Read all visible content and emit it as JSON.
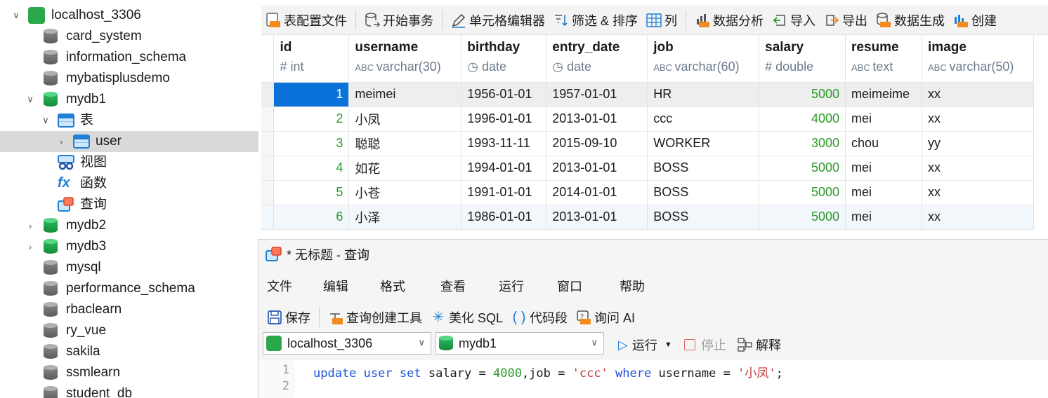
{
  "sidebar": {
    "connection": "localhost_3306",
    "databases": [
      "card_system",
      "information_schema",
      "mybatisplusdemo",
      "mydb1"
    ],
    "mydb1_children": {
      "tables_label": "表",
      "table_user": "user",
      "views_label": "视图",
      "functions_label": "函数",
      "queries_label": "查询"
    },
    "more_databases": [
      "mydb2",
      "mydb3",
      "mysql",
      "performance_schema",
      "rbaclearn",
      "ry_vue",
      "sakila",
      "ssmlearn",
      "student_db"
    ]
  },
  "toolbar": {
    "table_config": "表配置文件",
    "begin_tx": "开始事务",
    "cell_editor": "单元格编辑器",
    "filter_sort": "筛选 & 排序",
    "columns": "列",
    "data_analysis": "数据分析",
    "import": "导入",
    "export": "导出",
    "data_gen": "数据生成",
    "create": "创建"
  },
  "grid": {
    "columns": [
      {
        "name": "id",
        "type": "int"
      },
      {
        "name": "username",
        "type": "varchar(30)"
      },
      {
        "name": "birthday",
        "type": "date"
      },
      {
        "name": "entry_date",
        "type": "date"
      },
      {
        "name": "job",
        "type": "varchar(60)"
      },
      {
        "name": "salary",
        "type": "double"
      },
      {
        "name": "resume",
        "type": "text"
      },
      {
        "name": "image",
        "type": "varchar(50)"
      }
    ],
    "rows": [
      [
        "1",
        "meimei",
        "1956-01-01",
        "1957-01-01",
        "HR",
        "5000",
        "meimeime",
        "xx"
      ],
      [
        "2",
        "小凤",
        "1996-01-01",
        "2013-01-01",
        "ccc",
        "4000",
        "mei",
        "xx"
      ],
      [
        "3",
        "聪聪",
        "1993-11-11",
        "2015-09-10",
        "WORKER",
        "3000",
        "chou",
        "yy"
      ],
      [
        "4",
        "如花",
        "1994-01-01",
        "2013-01-01",
        "BOSS",
        "5000",
        "mei",
        "xx"
      ],
      [
        "5",
        "小苍",
        "1991-01-01",
        "2014-01-01",
        "BOSS",
        "5000",
        "mei",
        "xx"
      ],
      [
        "6",
        "小泽",
        "1986-01-01",
        "2013-01-01",
        "BOSS",
        "5000",
        "mei",
        "xx"
      ]
    ]
  },
  "query": {
    "title": "* 无标题 - 查询",
    "menu": [
      "文件",
      "编辑",
      "格式",
      "查看",
      "运行",
      "窗口",
      "帮助"
    ],
    "tools": {
      "save": "保存",
      "builder": "查询创建工具",
      "beautify": "美化 SQL",
      "snippet": "代码段",
      "ask_ai": "询问 AI"
    },
    "connection_select": "localhost_3306",
    "database_select": "mydb1",
    "run": "运行",
    "stop": "停止",
    "explain": "解释",
    "line_numbers": [
      "1",
      "2"
    ],
    "sql": {
      "kw1": "update",
      "kw2": "user",
      "kw3": "set",
      "t1": "salary =",
      "n1": "4000",
      "t2": ",job =",
      "s1": "'ccc'",
      "kw4": "where",
      "t3": "username =",
      "s2": "'小凤'",
      "t4": ";"
    }
  },
  "colors": {
    "accent": "#0b72d9",
    "keyword": "#1b52d8",
    "number": "#2d9b2a",
    "string": "#c23a3a"
  }
}
